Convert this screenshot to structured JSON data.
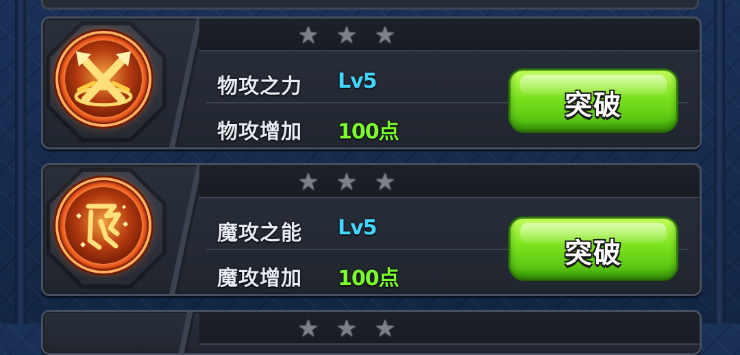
{
  "cards": [
    {
      "icon": "crossed-swords-icon",
      "stars": [
        "star",
        "star",
        "star"
      ],
      "stat_name": "物攻之力",
      "level": "Lv5",
      "bonus_name": "物攻增加",
      "bonus_value": "100点",
      "button_label": "突破"
    },
    {
      "icon": "magic-rune-icon",
      "stars": [
        "star",
        "star",
        "star"
      ],
      "stat_name": "魔攻之能",
      "level": "Lv5",
      "bonus_name": "魔攻增加",
      "bonus_value": "100点",
      "button_label": "突破"
    }
  ],
  "glyphs": {
    "star": "★"
  },
  "colors": {
    "level": "#45d6ff",
    "bonus_value": "#7cff2c",
    "button": "#6fd41a",
    "icon_disc": "#e0501a",
    "star": "#7c8088"
  }
}
